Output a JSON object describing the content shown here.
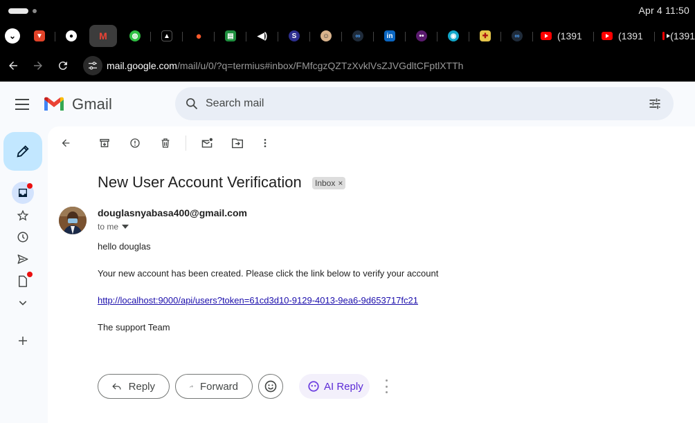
{
  "system": {
    "clock": "Apr 4  11:50"
  },
  "tabs": {
    "icons": [
      "gitlab-icon",
      "github-icon",
      "gmail-icon",
      "globe-icon",
      "vercel-icon",
      "tinder-icon",
      "sheets-icon",
      "audio-icon",
      "fedora-icon",
      "ghost-icon",
      "meta-icon",
      "linkedin-icon",
      "chat-icon",
      "eye-icon",
      "gamepad-icon",
      "meta-icon"
    ],
    "youtube_label": "(1391"
  },
  "address": {
    "host": "mail.google.com",
    "path": "/mail/u/0/?q=termius#inbox/FMfcgzQZTzXvklVsZJVGdltCFptlXTTh"
  },
  "header": {
    "logo_text": "Gmail"
  },
  "search": {
    "placeholder": "Search mail"
  },
  "message": {
    "subject": "New User Account Verification",
    "label": "Inbox",
    "label_close": "×",
    "sender": "douglasnyabasa400@gmail.com",
    "to": "to me",
    "greeting": "hello douglas",
    "line1": "Your new account has been created. Please click the link below to verify your account",
    "link": "http://localhost:9000/api/users?token=61cd3d10-9129-4013-9ea6-9d653717fc21",
    "signoff": "The support Team"
  },
  "actions": {
    "reply": "Reply",
    "forward": "Forward",
    "ai_reply": "AI Reply"
  },
  "colors": {
    "accent": "#c2e7ff",
    "search_bg": "#e9eef6",
    "link": "#1a0dab",
    "ai": "#5b2ad6",
    "badge": "#ea1010"
  }
}
